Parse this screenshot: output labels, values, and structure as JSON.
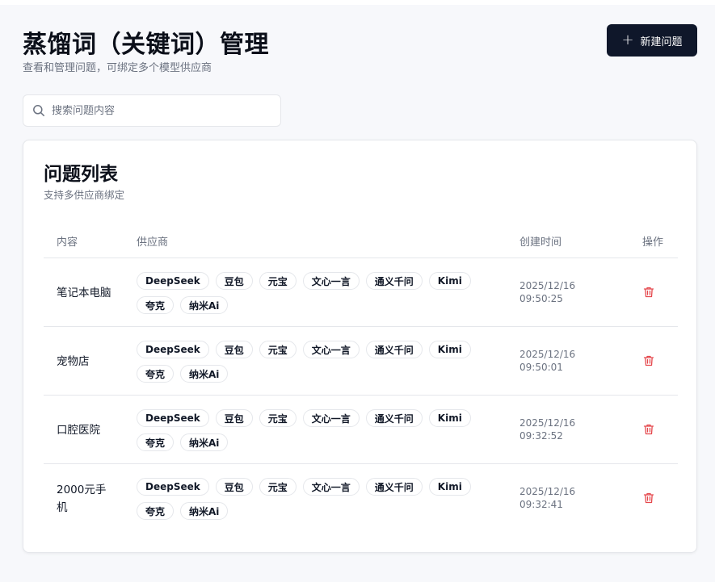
{
  "header": {
    "title": "蒸馏词（关键词）管理",
    "subtitle": "查看和管理问题，可绑定多个模型供应商",
    "new_button_label": "新建问题"
  },
  "search": {
    "placeholder": "搜索问题内容",
    "value": ""
  },
  "card": {
    "title": "问题列表",
    "subtitle": "支持多供应商绑定"
  },
  "table": {
    "headers": {
      "content": "内容",
      "provider": "供应商",
      "created": "创建时间",
      "actions": "操作"
    },
    "rows": [
      {
        "content": "笔记本电脑",
        "providers": [
          "DeepSeek",
          "豆包",
          "元宝",
          "文心一言",
          "通义千问",
          "Kimi",
          "夸克",
          "纳米Ai"
        ],
        "date": "2025/12/16",
        "time": "09:50:25"
      },
      {
        "content": "宠物店",
        "providers": [
          "DeepSeek",
          "豆包",
          "元宝",
          "文心一言",
          "通义千问",
          "Kimi",
          "夸克",
          "纳米Ai"
        ],
        "date": "2025/12/16",
        "time": "09:50:01"
      },
      {
        "content": "口腔医院",
        "providers": [
          "DeepSeek",
          "豆包",
          "元宝",
          "文心一言",
          "通义千问",
          "Kimi",
          "夸克",
          "纳米Ai"
        ],
        "date": "2025/12/16",
        "time": "09:32:52"
      },
      {
        "content": "2000元手机",
        "providers": [
          "DeepSeek",
          "豆包",
          "元宝",
          "文心一言",
          "通义千问",
          "Kimi",
          "夸克",
          "纳米Ai"
        ],
        "date": "2025/12/16",
        "time": "09:32:41"
      }
    ]
  },
  "icons": {
    "new": "plus-icon",
    "search": "search-icon",
    "delete": "trash-icon"
  },
  "colors": {
    "primary": "#0f172a",
    "danger": "#e5484d",
    "muted": "#6b7280",
    "border": "#e5e7eb",
    "background": "#f7f8fb"
  }
}
